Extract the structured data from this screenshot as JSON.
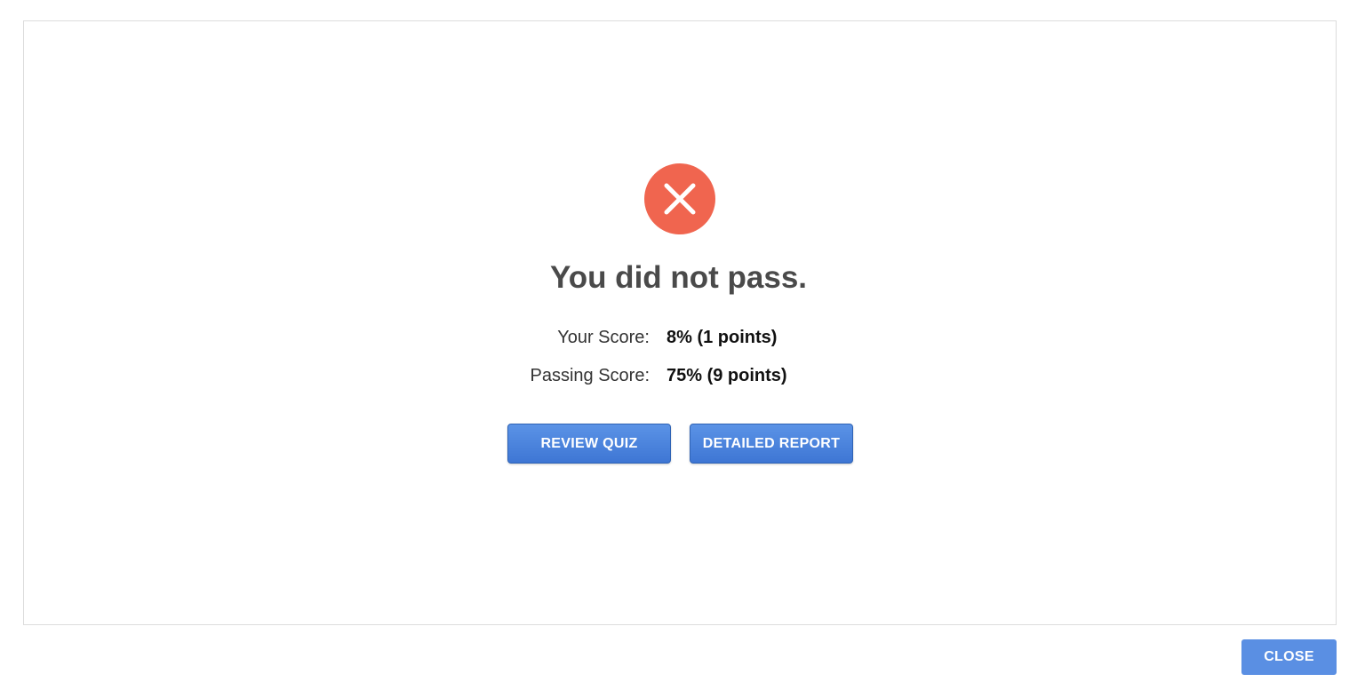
{
  "result": {
    "icon": "close-x-icon",
    "icon_color": "#f0654f",
    "title": "You did not pass."
  },
  "scores": {
    "your_score_label": "Your Score:",
    "your_score_value": "8% (1 points)",
    "passing_score_label": "Passing Score:",
    "passing_score_value": "75% (9 points)"
  },
  "actions": {
    "review_quiz_label": "REVIEW QUIZ",
    "detailed_report_label": "DETAILED REPORT"
  },
  "footer": {
    "close_label": "CLOSE"
  },
  "colors": {
    "accent": "#4a84dc",
    "fail": "#f0654f"
  }
}
